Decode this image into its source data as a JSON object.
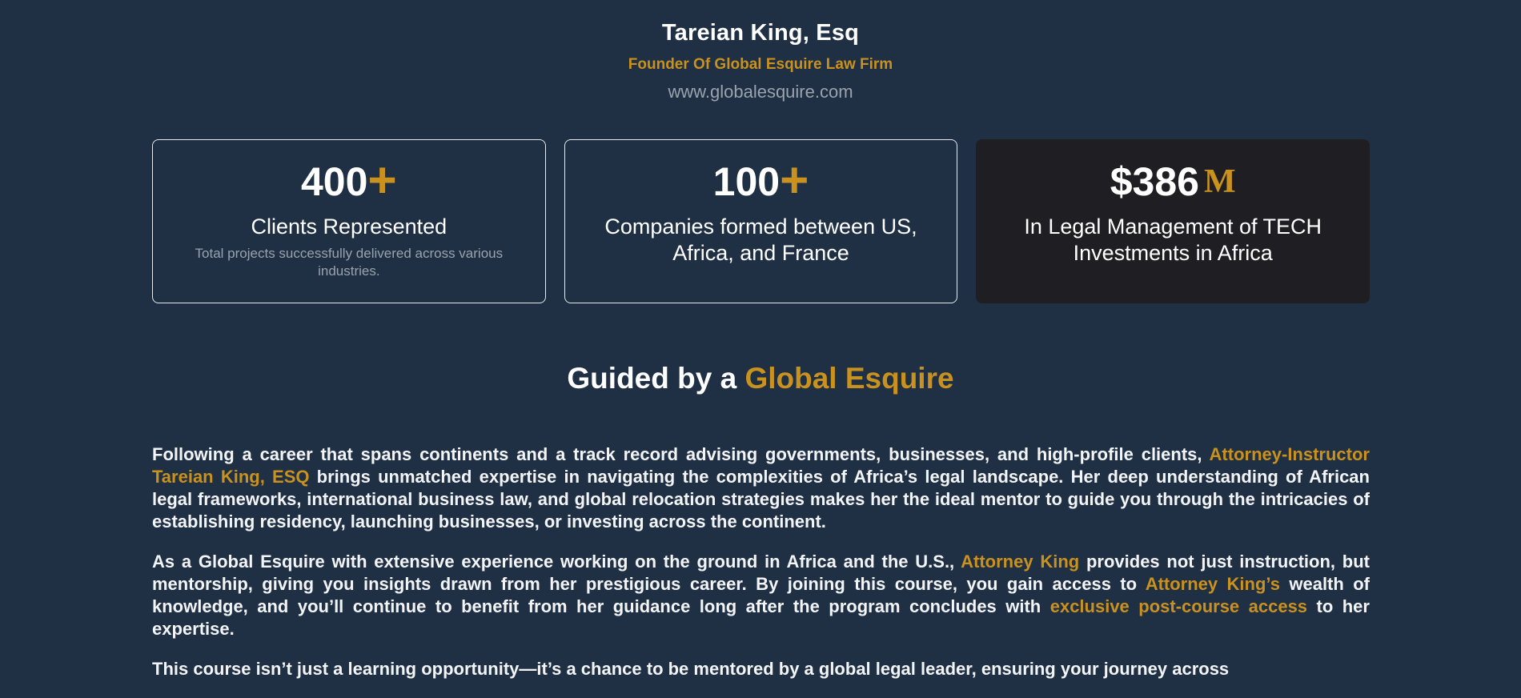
{
  "header": {
    "name": "Tareian King, Esq",
    "role": "Founder Of Global Esquire Law Firm",
    "website": "www.globalesquire.com"
  },
  "stats": [
    {
      "number": "400",
      "suffix": "+",
      "label": "Clients Represented",
      "sub": "Total projects successfully delivered across various industries."
    },
    {
      "number": "100",
      "suffix": "+",
      "label": "Companies formed between US, Africa, and France"
    },
    {
      "number": "$386",
      "suffix": "M",
      "label": "In Legal Management of TECH Investments in Africa"
    }
  ],
  "section": {
    "title_white": "Guided by a",
    "title_gold": "Global Esquire"
  },
  "paragraphs": {
    "p1": {
      "a": "Following a career that spans continents and a track record advising governments, businesses, and high-profile clients, ",
      "b": "Attorney-Instructor Tareian King, ESQ",
      "c": " brings unmatched expertise in navigating the complexities of Africa’s legal landscape. Her deep understanding of African legal frameworks, international business law, and global relocation strategies makes her the ideal mentor to guide you through the intricacies of establishing residency, launching businesses, or investing across the continent."
    },
    "p2": {
      "a": "As a Global Esquire with extensive experience working on the ground in Africa and the U.S., ",
      "b": "Attorney King",
      "c": " provides not just instruction, but mentorship, giving you insights drawn from her prestigious career. By joining this course, you gain access to ",
      "d": "Attorney King’s",
      "e": " wealth of knowledge, and you’ll continue to benefit from her guidance long after the program concludes with ",
      "f": "exclusive post-course access",
      "g": " to her expertise."
    },
    "p3": {
      "a": "This course isn’t just a learning opportunity—it’s a chance to be mentored by a global legal leader, ensuring your journey across"
    }
  },
  "colors": {
    "background": "#1f2f44",
    "accent": "#c9911d",
    "dark_card": "#1f1f23"
  }
}
